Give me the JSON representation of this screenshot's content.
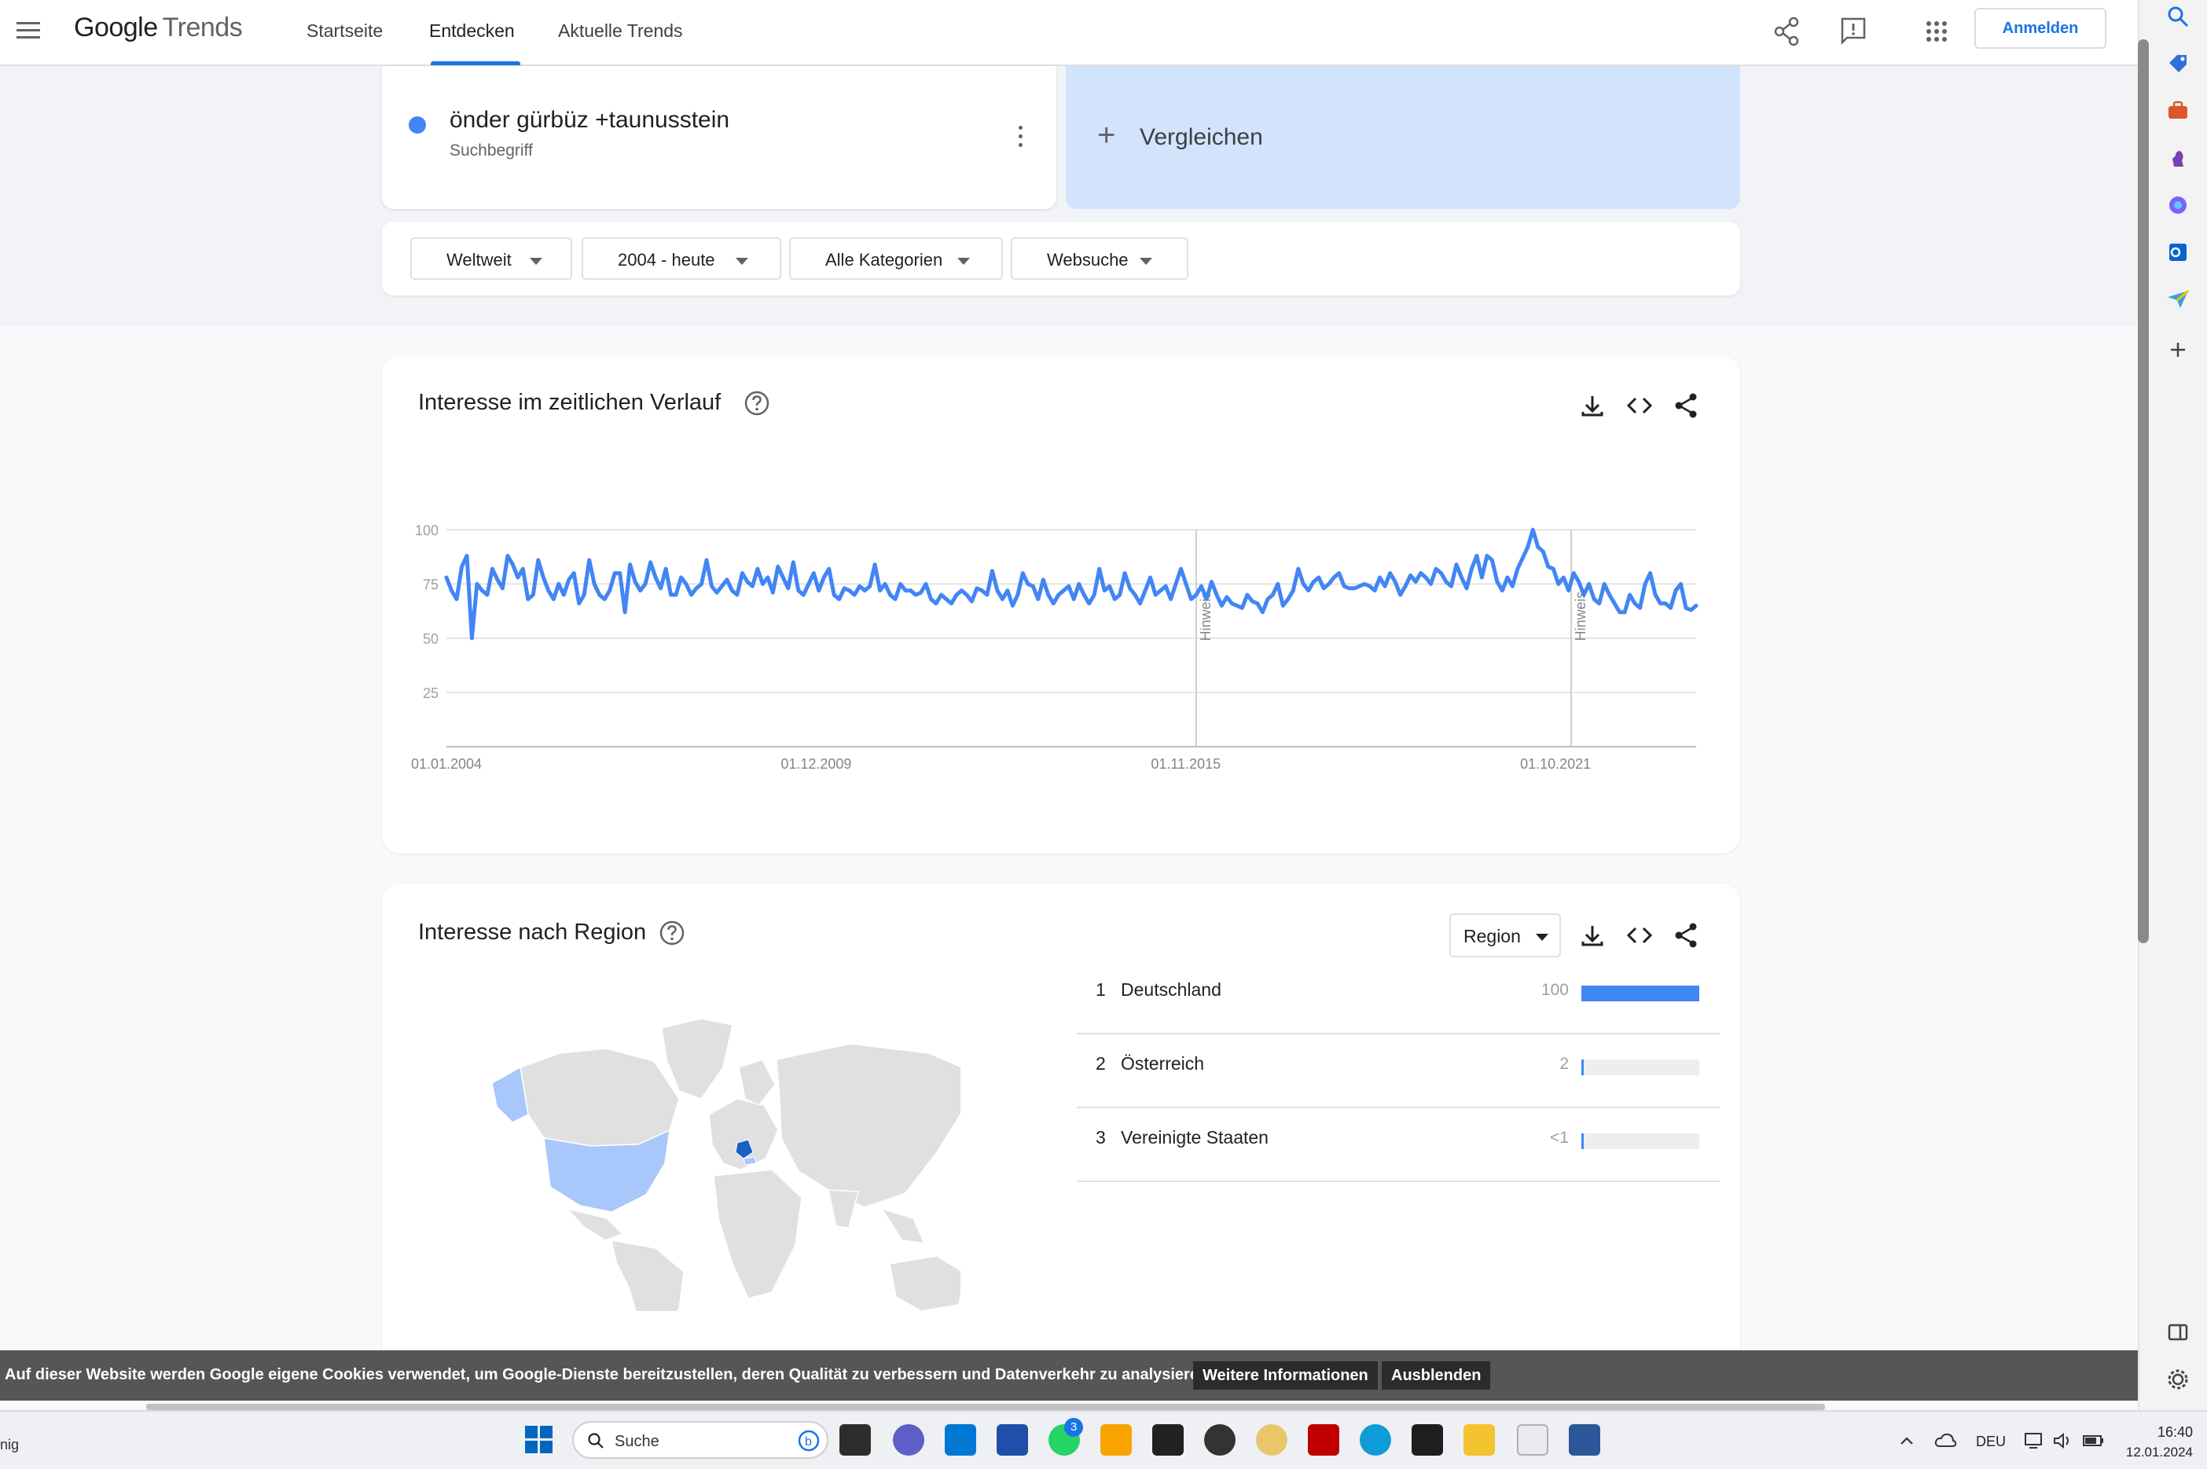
{
  "header": {
    "logo_google": "Google",
    "logo_trends": "Trends",
    "tabs": [
      {
        "label": "Startseite"
      },
      {
        "label": "Entdecken"
      },
      {
        "label": "Aktuelle Trends"
      }
    ],
    "signin_label": "Anmelden"
  },
  "search_term": {
    "text": "önder gürbüz +taunusstein",
    "type_label": "Suchbegriff",
    "color": "#4285f4"
  },
  "compare": {
    "label": "Vergleichen"
  },
  "filters": [
    {
      "label": "Weltweit"
    },
    {
      "label": "2004 - heute"
    },
    {
      "label": "Alle Kategorien"
    },
    {
      "label": "Websuche"
    }
  ],
  "time_card": {
    "title": "Interesse im zeitlichen Verlauf",
    "note_label": "Hinweis"
  },
  "chart_data": {
    "type": "line",
    "title": "",
    "x_tick_labels": [
      "01.01.2004",
      "01.12.2009",
      "01.11.2015",
      "01.10.2021"
    ],
    "y_ticks": [
      25,
      50,
      75,
      100
    ],
    "ylim": [
      0,
      100
    ],
    "x_range": [
      "2004-01",
      "2024-01"
    ],
    "grid": true,
    "annotations": [
      {
        "label": "Hinweis",
        "x": "2016-01"
      },
      {
        "label": "Hinweis",
        "x": "2022-01"
      }
    ],
    "series": [
      {
        "color": "#4285f4",
        "values": [
          78,
          72,
          68,
          83,
          88,
          50,
          75,
          72,
          70,
          82,
          77,
          73,
          88,
          84,
          78,
          82,
          68,
          70,
          86,
          78,
          72,
          68,
          75,
          70,
          77,
          80,
          66,
          70,
          86,
          75,
          70,
          68,
          72,
          80,
          80,
          62,
          84,
          76,
          72,
          75,
          85,
          78,
          73,
          82,
          70,
          70,
          78,
          75,
          70,
          73,
          75,
          86,
          74,
          71,
          74,
          77,
          72,
          70,
          80,
          76,
          74,
          82,
          75,
          78,
          71,
          83,
          78,
          73,
          85,
          72,
          70,
          75,
          80,
          72,
          78,
          82,
          70,
          68,
          73,
          72,
          70,
          74,
          72,
          74,
          84,
          72,
          75,
          70,
          68,
          75,
          72,
          72,
          70,
          71,
          75,
          68,
          66,
          70,
          68,
          66,
          70,
          72,
          70,
          67,
          73,
          72,
          70,
          81,
          72,
          68,
          72,
          65,
          70,
          80,
          75,
          74,
          68,
          77,
          70,
          66,
          70,
          72,
          74,
          68,
          75,
          70,
          66,
          70,
          82,
          72,
          74,
          68,
          70,
          80,
          73,
          70,
          66,
          72,
          78,
          70,
          72,
          74,
          68,
          75,
          82,
          75,
          68,
          70,
          74,
          68,
          76,
          70,
          65,
          69,
          66,
          65,
          64,
          70,
          67,
          66,
          62,
          68,
          70,
          75,
          65,
          68,
          72,
          82,
          75,
          72,
          76,
          78,
          73,
          75,
          78,
          80,
          74,
          73,
          73,
          74,
          75,
          74,
          72,
          78,
          74,
          80,
          76,
          70,
          74,
          79,
          76,
          80,
          78,
          75,
          82,
          80,
          76,
          74,
          84,
          78,
          73,
          82,
          88,
          78,
          88,
          86,
          76,
          72,
          78,
          74,
          82,
          87,
          92,
          100,
          92,
          90,
          83,
          82,
          75,
          78,
          72,
          80,
          76,
          70,
          75,
          68,
          66,
          75,
          70,
          66,
          62,
          62,
          70,
          66,
          64,
          75,
          80,
          70,
          66,
          66,
          64,
          72,
          75,
          64,
          63,
          65
        ]
      }
    ]
  },
  "region_card": {
    "title": "Interesse nach Region",
    "select_label": "Region",
    "rows": [
      {
        "rank": "1",
        "name": "Deutschland",
        "value": "100",
        "fill": 1.0
      },
      {
        "rank": "2",
        "name": "Österreich",
        "value": "2",
        "fill": 0.02
      },
      {
        "rank": "3",
        "name": "Vereinigte Staaten",
        "value": "<1",
        "fill": 0.005
      }
    ]
  },
  "cookie_bar": {
    "text": "Auf dieser Website werden Google eigene Cookies verwendet, um Google-Dienste bereitzustellen, deren Qualität zu verbessern und Datenverkehr zu analysieren.",
    "more_info_label": "Weitere Informationen",
    "dismiss_label": "Ausblenden"
  },
  "taskbar": {
    "left_text": "nig",
    "search_label": "Suche",
    "whatsapp_badge": "3",
    "language": "DEU",
    "time": "16:40",
    "date": "12.01.2024"
  },
  "colors": {
    "accent": "#1a73e8",
    "series": "#4285f4",
    "compare_bg": "#d2e3fc",
    "map_highlight_strong": "#1a5fc4",
    "map_highlight_light": "#a8c7fa"
  }
}
